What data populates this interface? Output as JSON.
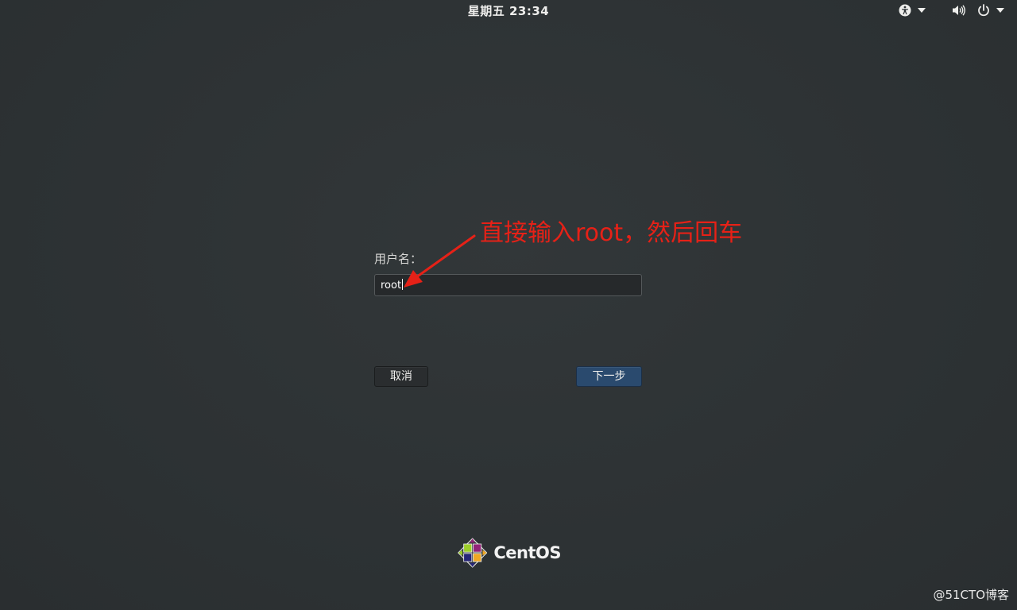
{
  "topbar": {
    "clock": "星期五 23:34",
    "icons": [
      "accessibility-icon",
      "volume-icon",
      "power-icon"
    ]
  },
  "login": {
    "username_label": "用户名：",
    "username_value": "root",
    "cancel_label": "取消",
    "next_label": "下一步"
  },
  "annotation": {
    "text": "直接输入root，然后回车",
    "color": "#e62117"
  },
  "branding": {
    "logo_text": "CentOS"
  },
  "watermark": {
    "text": "@51CTO博客"
  },
  "colors": {
    "background": "#2e3336",
    "next_button": "#2a4a6e",
    "annotation": "#e62117"
  }
}
